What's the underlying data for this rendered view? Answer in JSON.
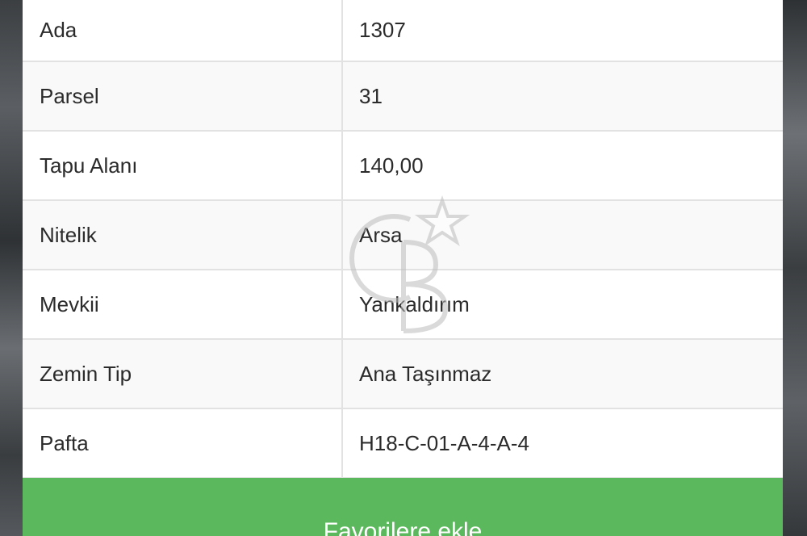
{
  "details": {
    "rows": [
      {
        "label": "Ada",
        "value": "1307"
      },
      {
        "label": "Parsel",
        "value": "31"
      },
      {
        "label": "Tapu Alanı",
        "value": "140,00"
      },
      {
        "label": "Nitelik",
        "value": "Arsa"
      },
      {
        "label": "Mevkii",
        "value": "Yankaldırım"
      },
      {
        "label": "Zemin Tip",
        "value": "Ana Taşınmaz"
      },
      {
        "label": "Pafta",
        "value": "H18-C-01-A-4-A-4"
      }
    ]
  },
  "actions": {
    "favorite_label": "Favorilere ekle"
  },
  "colors": {
    "button_green": "#5cb85c",
    "border": "#e2e2e2"
  },
  "watermark": {
    "icon": "cb-logo-star-icon"
  }
}
